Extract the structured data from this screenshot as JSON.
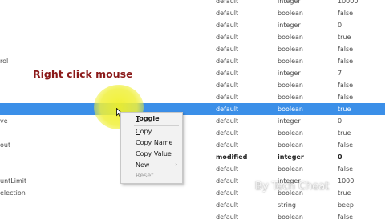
{
  "annotation": "Right click mouse",
  "rows": [
    {
      "name": "",
      "status": "default",
      "type": "integer",
      "value": "10000"
    },
    {
      "name": "",
      "status": "default",
      "type": "boolean",
      "value": "false"
    },
    {
      "name": "",
      "status": "default",
      "type": "integer",
      "value": "0"
    },
    {
      "name": "",
      "status": "default",
      "type": "boolean",
      "value": "true"
    },
    {
      "name": "",
      "status": "default",
      "type": "boolean",
      "value": "false"
    },
    {
      "name": "rol",
      "status": "default",
      "type": "boolean",
      "value": "false"
    },
    {
      "name": "",
      "status": "default",
      "type": "integer",
      "value": "7"
    },
    {
      "name": "",
      "status": "default",
      "type": "boolean",
      "value": "false"
    },
    {
      "name": "",
      "status": "default",
      "type": "boolean",
      "value": "false"
    },
    {
      "name": "",
      "status": "default",
      "type": "boolean",
      "value": "true"
    },
    {
      "name": "ve",
      "status": "default",
      "type": "integer",
      "value": "0"
    },
    {
      "name": "",
      "status": "default",
      "type": "boolean",
      "value": "true"
    },
    {
      "name": "out",
      "status": "default",
      "type": "boolean",
      "value": "false"
    },
    {
      "name": "",
      "status": "modified",
      "type": "integer",
      "value": "0"
    },
    {
      "name": "",
      "status": "default",
      "type": "boolean",
      "value": "false"
    },
    {
      "name": "untLimit",
      "status": "default",
      "type": "integer",
      "value": "1000"
    },
    {
      "name": "election",
      "status": "default",
      "type": "boolean",
      "value": "true"
    },
    {
      "name": "",
      "status": "default",
      "type": "string",
      "value": "beep"
    },
    {
      "name": "",
      "status": "default",
      "type": "boolean",
      "value": "false"
    }
  ],
  "context_menu": {
    "toggle": "Toggle",
    "copy": "Copy",
    "copy_name": "Copy Name",
    "copy_value": "Copy Value",
    "new": "New",
    "reset": "Reset"
  },
  "watermark": "By Tech Cheat"
}
